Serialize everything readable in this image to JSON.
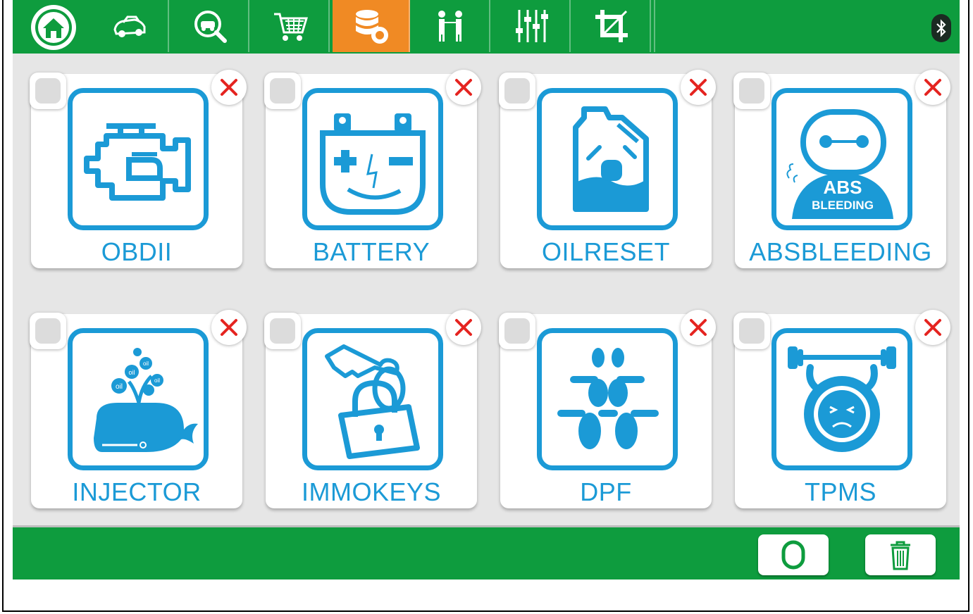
{
  "topbar": {
    "tabs": [
      {
        "icon": "home-icon",
        "active": false
      },
      {
        "icon": "car-icon",
        "active": false
      },
      {
        "icon": "car-search-icon",
        "active": false
      },
      {
        "icon": "shopping-cart-icon",
        "active": false
      },
      {
        "icon": "database-gear-icon",
        "active": true
      },
      {
        "icon": "people-icon",
        "active": false
      },
      {
        "icon": "sliders-icon",
        "active": false
      },
      {
        "icon": "crop-icon",
        "active": false
      }
    ],
    "status_icon": "bluetooth-icon"
  },
  "cards": [
    {
      "label": "OBDII",
      "icon": "engine-icon"
    },
    {
      "label": "BATTERY",
      "icon": "battery-icon"
    },
    {
      "label": "OILRESET",
      "icon": "oil-can-icon"
    },
    {
      "label": "ABSBLEEDING",
      "icon": "abs-bleeding-icon",
      "icon_text": [
        "ABS",
        "BLEEDING"
      ]
    },
    {
      "label": "INJECTOR",
      "icon": "whale-icon",
      "icon_text": "oil"
    },
    {
      "label": "IMMOKEYS",
      "icon": "key-lock-icon"
    },
    {
      "label": "DPF",
      "icon": "dpf-filter-icon"
    },
    {
      "label": "TPMS",
      "icon": "tire-weightlifter-icon"
    }
  ],
  "bottombar": {
    "buttons": [
      {
        "icon": "circle-select-icon"
      },
      {
        "icon": "trash-icon"
      }
    ]
  },
  "colors": {
    "green": "#0e9c3e",
    "orange": "#f08a24",
    "blue": "#1b9ad6",
    "red": "#e52420"
  }
}
